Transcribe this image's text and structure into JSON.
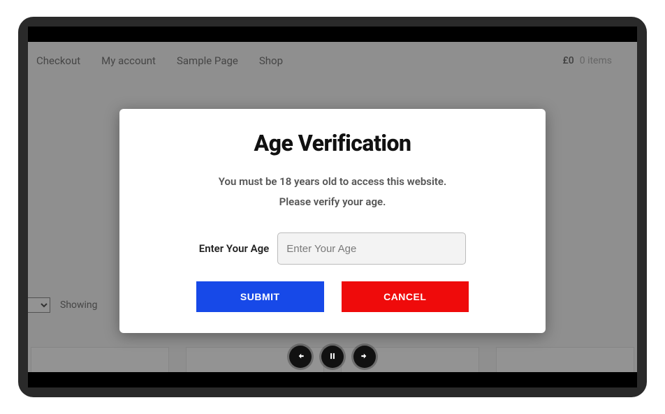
{
  "nav": {
    "items": [
      "Checkout",
      "My account",
      "Sample Page",
      "Shop"
    ],
    "cart": {
      "price": "£0",
      "count": "0 items"
    }
  },
  "listing": {
    "showing_label": "Showing"
  },
  "modal": {
    "title": "Age Verification",
    "line1": "You must be 18 years old to access this website.",
    "line2": "Please verify your age.",
    "input_label": "Enter Your Age",
    "input_placeholder": "Enter Your Age",
    "submit_label": "SUBMIT",
    "cancel_label": "CANCEL"
  }
}
